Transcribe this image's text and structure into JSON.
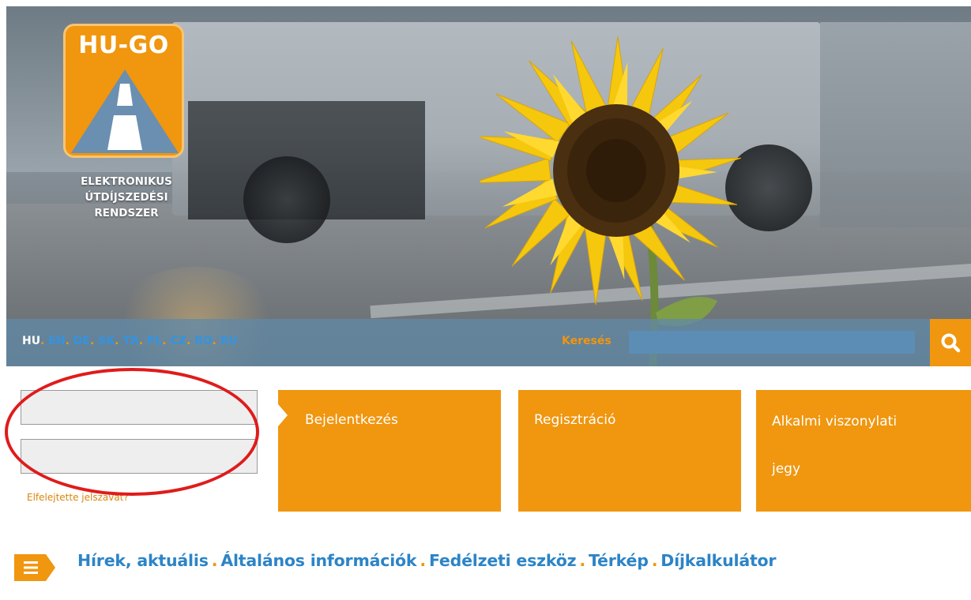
{
  "logo": {
    "title": "HU-GO",
    "subtitle_lines": [
      "ELEKTRONIKUS",
      "ÚTDÍJSZEDÉSI",
      "RENDSZER"
    ]
  },
  "languages": [
    {
      "code": "HU",
      "active": true
    },
    {
      "code": "EN",
      "active": false
    },
    {
      "code": "DE",
      "active": false
    },
    {
      "code": "SK",
      "active": false
    },
    {
      "code": "TR",
      "active": false
    },
    {
      "code": "PL",
      "active": false
    },
    {
      "code": "CZ",
      "active": false
    },
    {
      "code": "RO",
      "active": false
    },
    {
      "code": "RU",
      "active": false
    }
  ],
  "language_separator": ".",
  "search": {
    "label": "Keresés",
    "value": "",
    "icon": "search-icon"
  },
  "login": {
    "username_value": "",
    "password_value": "",
    "forgot_password": "Elfelejtette jelszavát?",
    "highlight_color": "#e01b1b"
  },
  "tiles": {
    "login": "Bejelentkezés",
    "registration": "Regisztráció",
    "ticket_line1": "Alkalmi viszonylati",
    "ticket_line2": "jegy"
  },
  "nav": {
    "menu_icon": "hamburger-icon",
    "separator": ".",
    "items": [
      "Hírek, aktuális",
      "Általános információk",
      "Fedélzeti eszköz",
      "Térkép",
      "Díjkalkulátor"
    ]
  },
  "colors": {
    "accent_orange": "#f0960f",
    "link_blue": "#2c84c7",
    "bar_blue": "#6289a6"
  }
}
